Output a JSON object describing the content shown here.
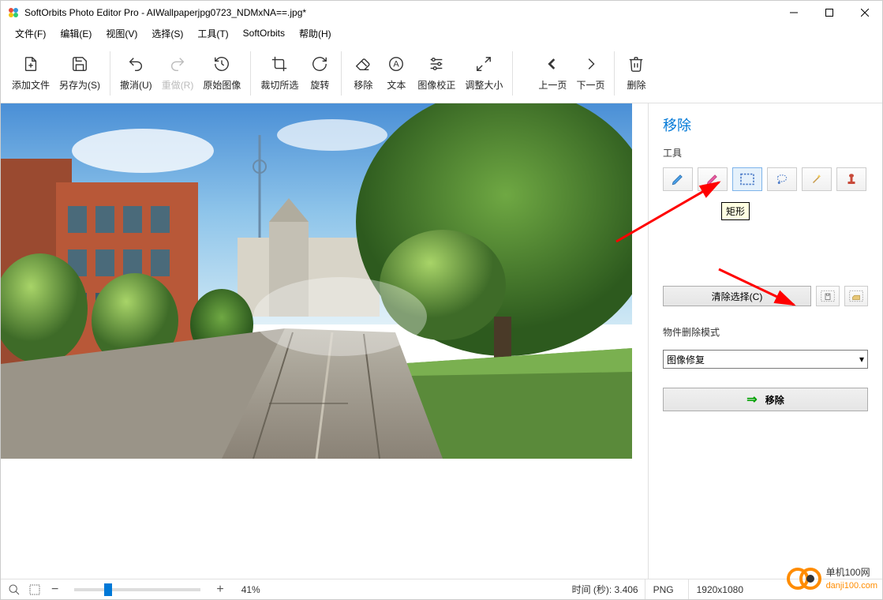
{
  "titlebar": {
    "title": "SoftOrbits Photo Editor Pro - AIWallpaperjpg0723_NDMxNA==.jpg*"
  },
  "menu": {
    "file": "文件(F)",
    "edit": "编辑(E)",
    "view": "视图(V)",
    "select": "选择(S)",
    "tools": "工具(T)",
    "softorbits": "SoftOrbits",
    "help": "帮助(H)"
  },
  "toolbar": {
    "add_file": "添加文件",
    "save_as": "另存为(S)",
    "undo": "撤消(U)",
    "redo": "重做(R)",
    "original": "原始图像",
    "crop": "裁切所选",
    "rotate": "旋转",
    "remove": "移除",
    "text": "文本",
    "correction": "图像校正",
    "resize": "调整大小",
    "prev": "上一页",
    "next": "下一页",
    "delete": "删除"
  },
  "panel": {
    "title": "移除",
    "tools_label": "工具",
    "tooltip": "矩形",
    "clear_selection": "清除选择(C)",
    "mode_label": "物件删除模式",
    "mode_value": "图像修复",
    "remove_action": "移除"
  },
  "status": {
    "zoom": "41%",
    "time_label": "时间 (秒): 3.406",
    "format": "PNG",
    "dimensions": "1920x1080"
  },
  "watermark": {
    "line1": "单机100网"
  }
}
